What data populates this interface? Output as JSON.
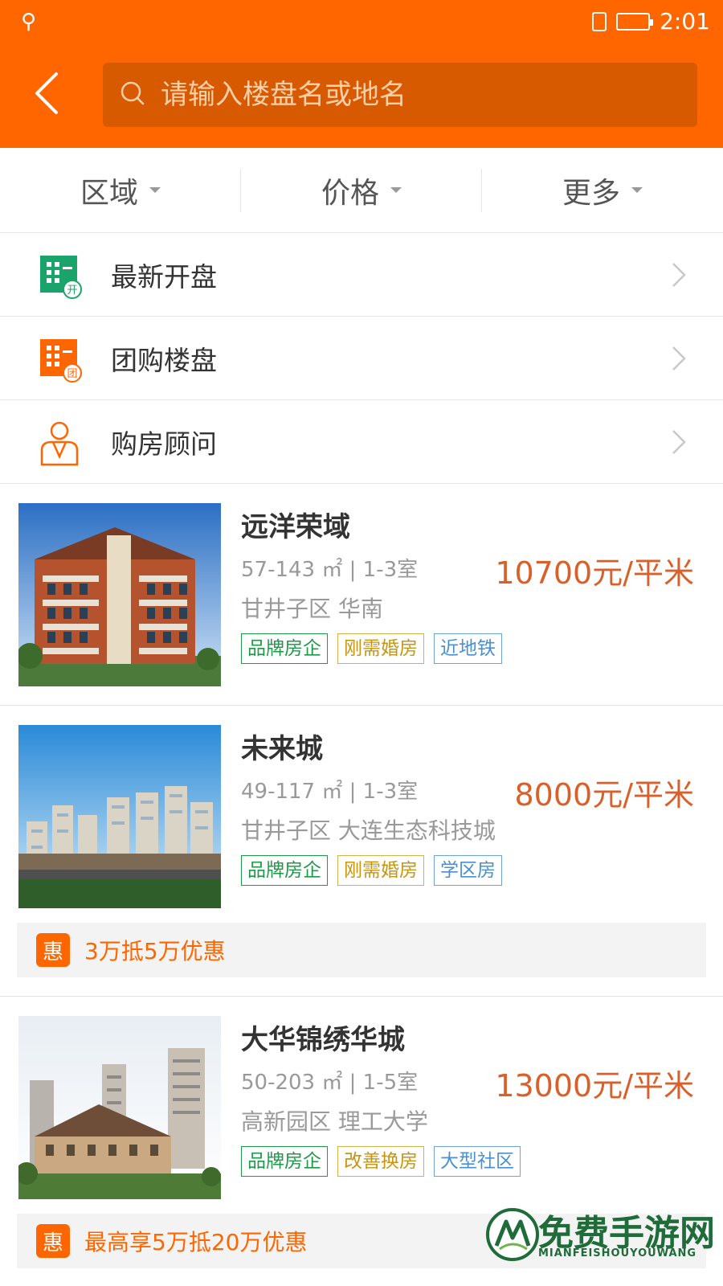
{
  "status": {
    "time": "2:01"
  },
  "search": {
    "placeholder": "请输入楼盘名或地名"
  },
  "filters": [
    {
      "label": "区域"
    },
    {
      "label": "价格"
    },
    {
      "label": "更多"
    }
  ],
  "menu": [
    {
      "label": "最新开盘",
      "icon": "new-opening-icon",
      "badge": "开",
      "color": "#1aa36a"
    },
    {
      "label": "团购楼盘",
      "icon": "group-buy-icon",
      "badge": "团",
      "color": "#ff6600"
    },
    {
      "label": "购房顾问",
      "icon": "consultant-icon",
      "color": "#ff6600"
    }
  ],
  "listings": [
    {
      "name": "远洋荣域",
      "spec": "57-143 ㎡ | 1-3室",
      "area": "甘井子区 华南",
      "price": "10700元/平米",
      "tags": [
        "品牌房企",
        "刚需婚房",
        "近地铁"
      ],
      "promo": null
    },
    {
      "name": "未来城",
      "spec": "49-117 ㎡ | 1-3室",
      "area": "甘井子区 大连生态科技城",
      "price": "8000元/平米",
      "tags": [
        "品牌房企",
        "刚需婚房",
        "学区房"
      ],
      "promo": {
        "badge": "惠",
        "text": "3万抵5万优惠"
      }
    },
    {
      "name": "大华锦绣华城",
      "spec": "50-203 ㎡ | 1-5室",
      "area": "高新园区 理工大学",
      "price": "13000元/平米",
      "tags": [
        "品牌房企",
        "改善换房",
        "大型社区"
      ],
      "promo": {
        "badge": "惠",
        "text": "最高享5万抵20万优惠"
      }
    }
  ],
  "watermark": {
    "title": "免费手游网",
    "subtitle": "MIANFEISHOUYOUWANG"
  },
  "colors": {
    "brand": "#ff6600",
    "price": "#d9602a",
    "tag_green": "#1c9a48",
    "tag_gold": "#c8950c",
    "tag_blue": "#4a90d0"
  }
}
